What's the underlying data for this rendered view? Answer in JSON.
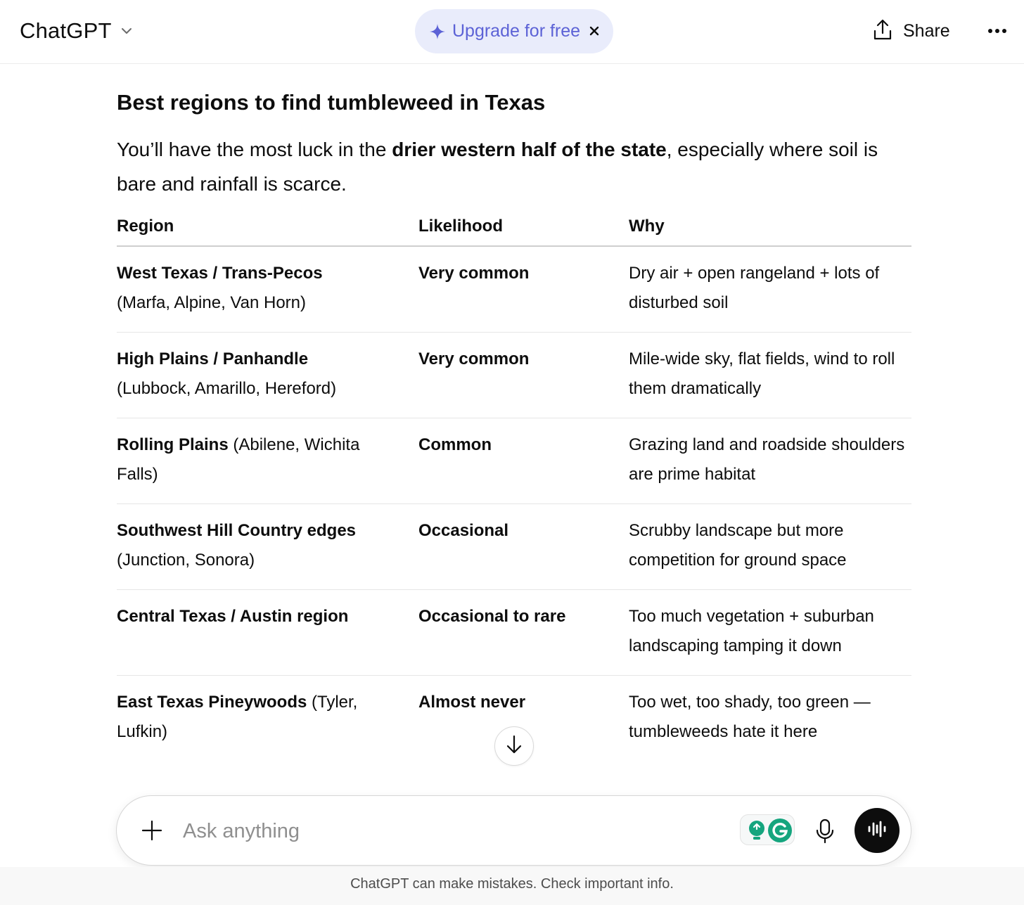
{
  "header": {
    "model_name": "ChatGPT",
    "upgrade_label": "Upgrade for free",
    "share_label": "Share"
  },
  "content": {
    "heading": "Best regions to find tumbleweed in Texas",
    "intro_before": "You’ll have the most luck in the ",
    "intro_bold": "drier western half of the state",
    "intro_after": ", especially where soil is bare and rainfall is scarce."
  },
  "table": {
    "headers": [
      "Region",
      "Likelihood",
      "Why"
    ],
    "rows": [
      {
        "region_bold": "West Texas / Trans-Pecos",
        "region_rest": "(Marfa, Alpine, Van Horn)",
        "likelihood": "Very common",
        "why": "Dry air + open rangeland + lots of disturbed soil"
      },
      {
        "region_bold": "High Plains / Panhandle",
        "region_rest": "(Lubbock, Amarillo, Hereford)",
        "likelihood": "Very common",
        "why": "Mile-wide sky, flat fields, wind to roll them dramatically"
      },
      {
        "region_bold": "Rolling Plains",
        "region_rest": " (Abilene, Wichita Falls)",
        "likelihood": "Common",
        "why": "Grazing land and roadside shoulders are prime habitat"
      },
      {
        "region_bold": "Southwest Hill Country edges",
        "region_rest": "(Junction, Sonora)",
        "likelihood": "Occasional",
        "why": "Scrubby landscape but more competition for ground space"
      },
      {
        "region_bold": "Central Texas / Austin region",
        "region_rest": "",
        "likelihood": "Occasional to rare",
        "why": "Too much vegetation + suburban landscaping tamping it down"
      },
      {
        "region_bold": "East Texas Pineywoods",
        "region_rest": " (Tyler, Lufkin)",
        "likelihood": "Almost never",
        "why": "Too wet, too shady, too green — tumbleweeds hate it here"
      }
    ]
  },
  "composer": {
    "placeholder": "Ask anything"
  },
  "footer": {
    "disclaimer": "ChatGPT can make mistakes. Check important info."
  },
  "colors": {
    "accent": "#5c62d6",
    "upgrade_bg": "#e9ecfb",
    "grammarly": "#15a57e"
  }
}
